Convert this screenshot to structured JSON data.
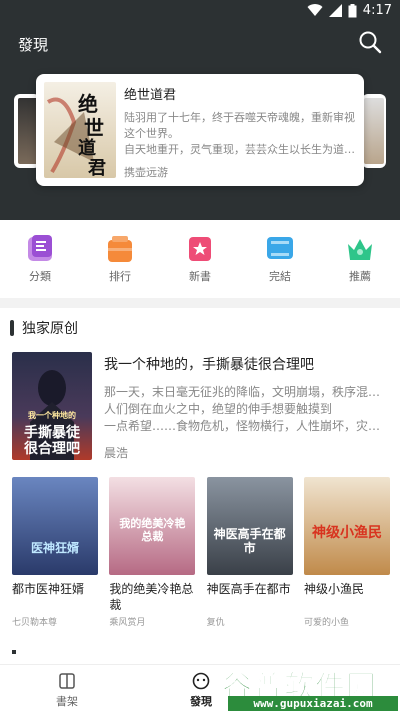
{
  "status_bar": {
    "time": "4:17"
  },
  "appbar": {
    "title": "發現"
  },
  "carousel": {
    "main": {
      "title": "绝世道君",
      "description_line1": "陆羽用了十七年，终于吞噬天帝魂魄，重新审视这个世界。",
      "description_line2": "自天地重开，灵气重现，芸芸众生以长生为道…",
      "author": "携壶远游",
      "cover_text_1": "绝",
      "cover_text_2": "世",
      "cover_text_3": "道",
      "cover_text_4": "君"
    }
  },
  "categories": [
    {
      "label": "分類",
      "icon": "category-icon",
      "color": "#b06ad8"
    },
    {
      "label": "排行",
      "icon": "ranking-icon",
      "color": "#f58a3a"
    },
    {
      "label": "新書",
      "icon": "new-book-icon",
      "color": "#ee4c76"
    },
    {
      "label": "完結",
      "icon": "finished-icon",
      "color": "#3aa7e8"
    },
    {
      "label": "推薦",
      "icon": "crown-icon",
      "color": "#2ec58a"
    }
  ],
  "section": {
    "title": "独家原创"
  },
  "featured": {
    "title": "我一个种地的，手撕暴徒很合理吧",
    "description_line1": "那一天，末日毫无征兆的降临，文明崩塌，秩序混乱，",
    "description_line2": "人们倒在血火之中，绝望的伸手想要触摸到",
    "description_line3": "一点希望……食物危机，怪物横行，人性崩坏，灾…",
    "author": "晨浩",
    "cover_text_1": "手撕暴徒",
    "cover_text_2": "很合理吧",
    "cover_text_small": "我一个种地的"
  },
  "books": [
    {
      "title": "都市医神狂婿",
      "author": "七贝勒本尊",
      "cover_text": "医神狂婿",
      "cover_bg": "#3a4c7a"
    },
    {
      "title": "我的绝美冷艳总裁",
      "author": "乘风赏月",
      "cover_text": "我的绝美冷艳总裁",
      "cover_bg": "#c98a9a"
    },
    {
      "title": "神医高手在都市",
      "author": "复仇",
      "cover_text": "神医高手在都市",
      "cover_bg": "#5a6470"
    },
    {
      "title": "神级小渔民",
      "author": "可爱的小鱼",
      "cover_text": "神级小渔民",
      "cover_bg": "#c9a06a"
    }
  ],
  "bottom_nav": [
    {
      "label": "書架",
      "icon": "bookshelf-icon"
    },
    {
      "label": "發現",
      "icon": "discover-icon"
    }
  ],
  "watermark": {
    "title": "谷普软件园",
    "url": "www.gupuxiazai.com"
  }
}
